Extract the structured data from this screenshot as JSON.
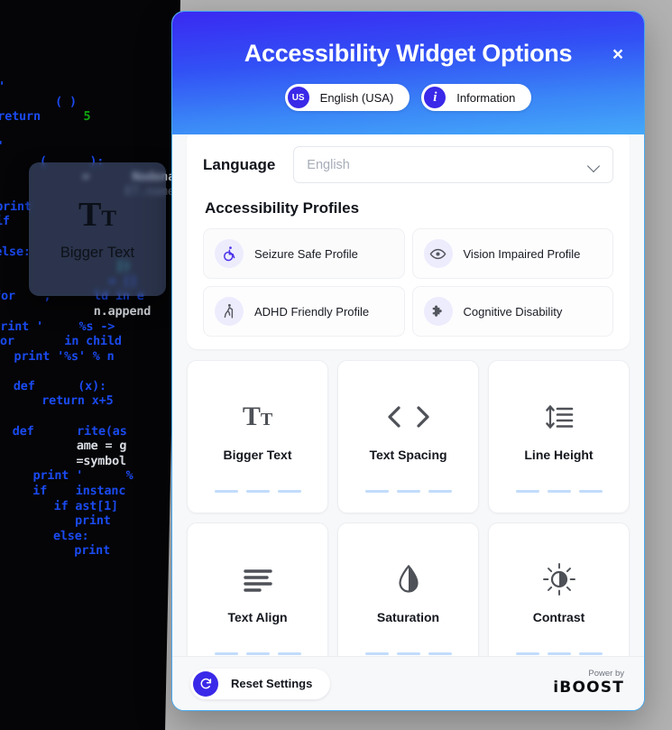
{
  "background": {
    "code_lines": [
      {
        "t": "'",
        "c": "k"
      },
      {
        "t": "        ( )",
        "c": "k"
      },
      {
        "t": "return      5",
        "c": "mix-return"
      },
      {
        "t": "",
        "c": "pl"
      },
      {
        "t": "'",
        "c": "k"
      },
      {
        "t": "      (      ):",
        "c": "k"
      },
      {
        "t": "            =      Nodename",
        "c": "wt"
      },
      {
        "t": "                  ET.name",
        "c": "gr"
      },
      {
        "t": "print",
        "c": "k"
      },
      {
        "t": "if",
        "c": "k"
      },
      {
        "t": "",
        "c": "pl"
      },
      {
        "t": "else:",
        "c": "k"
      },
      {
        "t": "                 ])",
        "c": "cy"
      },
      {
        "t": "                = []",
        "c": "k"
      },
      {
        "t": "for    ,      ld in e",
        "c": "k"
      },
      {
        "t": "              n.append",
        "c": "wt"
      },
      {
        "t": "print '     %s ->",
        "c": "k"
      },
      {
        "t": "for       in child",
        "c": "k"
      },
      {
        "t": "   print '%s' % n",
        "c": "k"
      },
      {
        "t": "",
        "c": "pl"
      },
      {
        "t": "   def      (x):",
        "c": "k"
      },
      {
        "t": "       return x+5",
        "c": "k"
      },
      {
        "t": "",
        "c": "pl"
      },
      {
        "t": "   def      rite(as",
        "c": "k"
      },
      {
        "t": "            ame = g",
        "c": "wt"
      },
      {
        "t": "            =symbol",
        "c": "wt"
      },
      {
        "t": "      print '      %",
        "c": "k"
      },
      {
        "t": "      if    instanc",
        "c": "k"
      },
      {
        "t": "         if ast[1]",
        "c": "k"
      },
      {
        "t": "            print",
        "c": "k"
      },
      {
        "t": "         else:",
        "c": "k"
      },
      {
        "t": "            print",
        "c": "k"
      }
    ],
    "float_card": {
      "icon": "bigger-text-icon",
      "icon_big": "T",
      "icon_small": "T",
      "label": "Bigger Text"
    }
  },
  "dialog": {
    "title": "Accessibility Widget Options",
    "close_label": "×",
    "pills": [
      {
        "badge": "US",
        "label": "English (USA)",
        "name": "language-pill"
      },
      {
        "badge": "i",
        "label": "Information",
        "name": "information-pill"
      }
    ],
    "language": {
      "label": "Language",
      "value": "English",
      "placeholder": "English"
    },
    "profiles_title": "Accessibility Profiles",
    "profiles": [
      {
        "label": "Seizure Safe Profile",
        "icon": "wheelchair-icon",
        "active": true
      },
      {
        "label": "Vision Impaired Profile",
        "icon": "eye-icon",
        "active": false
      },
      {
        "label": "ADHD Friendly Profile",
        "icon": "walking-cane-icon",
        "active": false
      },
      {
        "label": "Cognitive Disability",
        "icon": "puzzle-piece-icon",
        "active": false
      }
    ],
    "features": [
      {
        "label": "Bigger Text",
        "icon": "bigger-text-icon",
        "steps": 3
      },
      {
        "label": "Text Spacing",
        "icon": "text-spacing-icon",
        "steps": 3
      },
      {
        "label": "Line Height",
        "icon": "line-height-icon",
        "steps": 3
      },
      {
        "label": "Text Align",
        "icon": "text-align-icon",
        "steps": 3
      },
      {
        "label": "Saturation",
        "icon": "saturation-droplet-icon",
        "steps": 3
      },
      {
        "label": "Contrast",
        "icon": "contrast-sun-icon",
        "steps": 3
      }
    ],
    "footer": {
      "reset_label": "Reset Settings",
      "reset_icon": "refresh-icon",
      "brand_top": "Power by",
      "brand_name": "iBOOST"
    }
  },
  "colors": {
    "gradient_start": "#3a29f2",
    "gradient_end": "#45a8f8",
    "accent": "#3a29e8",
    "dash": "#c2dcfb",
    "page_bg": "#b2b2b2"
  }
}
